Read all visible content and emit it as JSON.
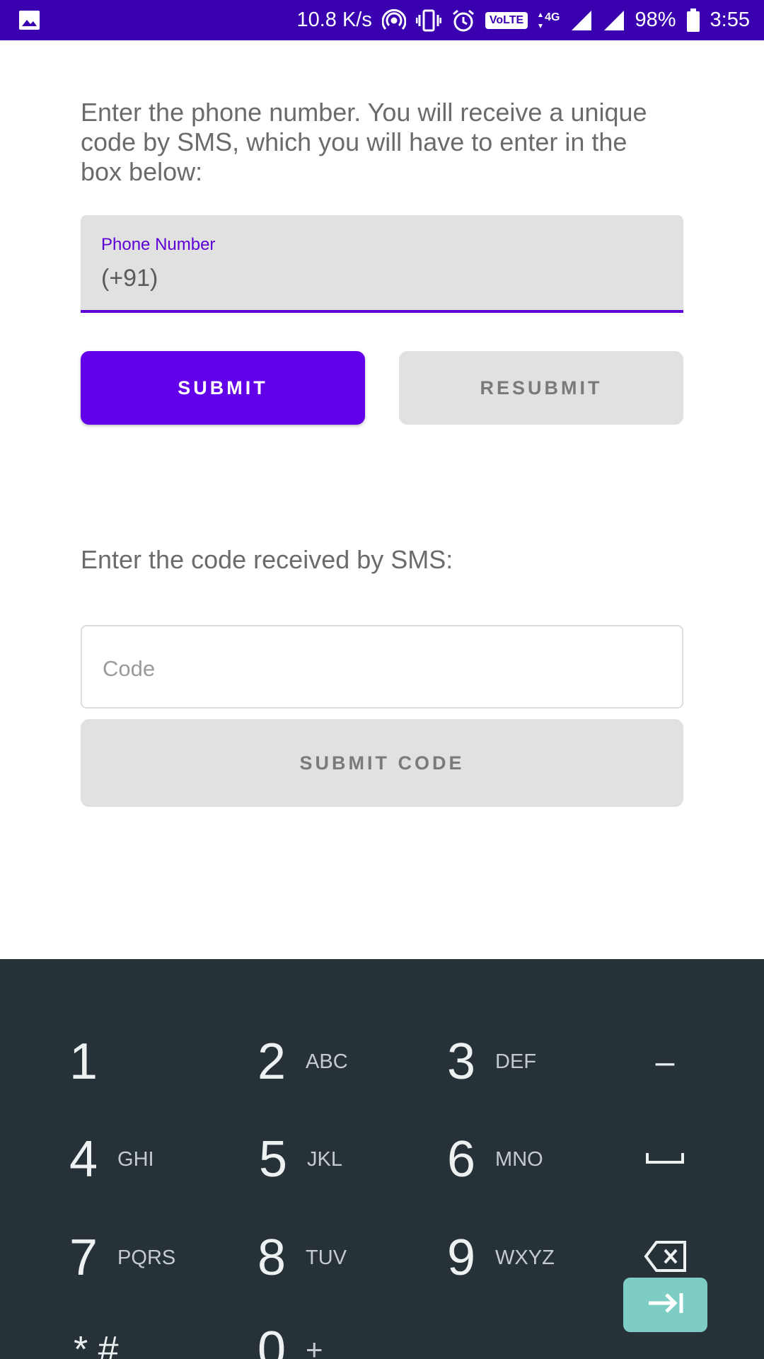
{
  "status_bar": {
    "speed": "10.8 K/s",
    "network": "4G",
    "volte": "VoLTE",
    "battery": "98%",
    "time": "3:55",
    "icons": [
      "image-icon",
      "hotspot-icon",
      "vibrate-icon",
      "alarm-icon",
      "volte-icon",
      "data-arrows-icon",
      "signal-icon",
      "signal-icon",
      "battery-icon"
    ]
  },
  "phone_section": {
    "instructions": "Enter the phone number. You will receive a unique code by SMS, which you will have to enter in the box below:",
    "field_label": "Phone Number",
    "field_value": "(+91)",
    "submit_label": "SUBMIT",
    "resubmit_label": "RESUBMIT"
  },
  "code_section": {
    "prompt": "Enter the code received by SMS:",
    "placeholder": "Code",
    "submit_label": "SUBMIT CODE"
  },
  "keyboard": {
    "keys": [
      {
        "num": "1",
        "sub": ""
      },
      {
        "num": "2",
        "sub": "ABC"
      },
      {
        "num": "3",
        "sub": "DEF"
      },
      {
        "num": "–",
        "sub": ""
      },
      {
        "num": "4",
        "sub": "GHI"
      },
      {
        "num": "5",
        "sub": "JKL"
      },
      {
        "num": "6",
        "sub": "MNO"
      },
      {
        "num": "space",
        "sub": ""
      },
      {
        "num": "7",
        "sub": "PQRS"
      },
      {
        "num": "8",
        "sub": "TUV"
      },
      {
        "num": "9",
        "sub": "WXYZ"
      },
      {
        "num": "backspace",
        "sub": ""
      },
      {
        "num": "* #",
        "sub": ""
      },
      {
        "num": "0",
        "sub": "+"
      },
      {
        "num": ".",
        "sub": ""
      },
      {
        "num": "next",
        "sub": ""
      }
    ]
  },
  "colors": {
    "status_bar": "#3a00b0",
    "primary": "#6200ea",
    "keyboard_bg": "#263238",
    "enter_key": "#7ecdc4"
  }
}
